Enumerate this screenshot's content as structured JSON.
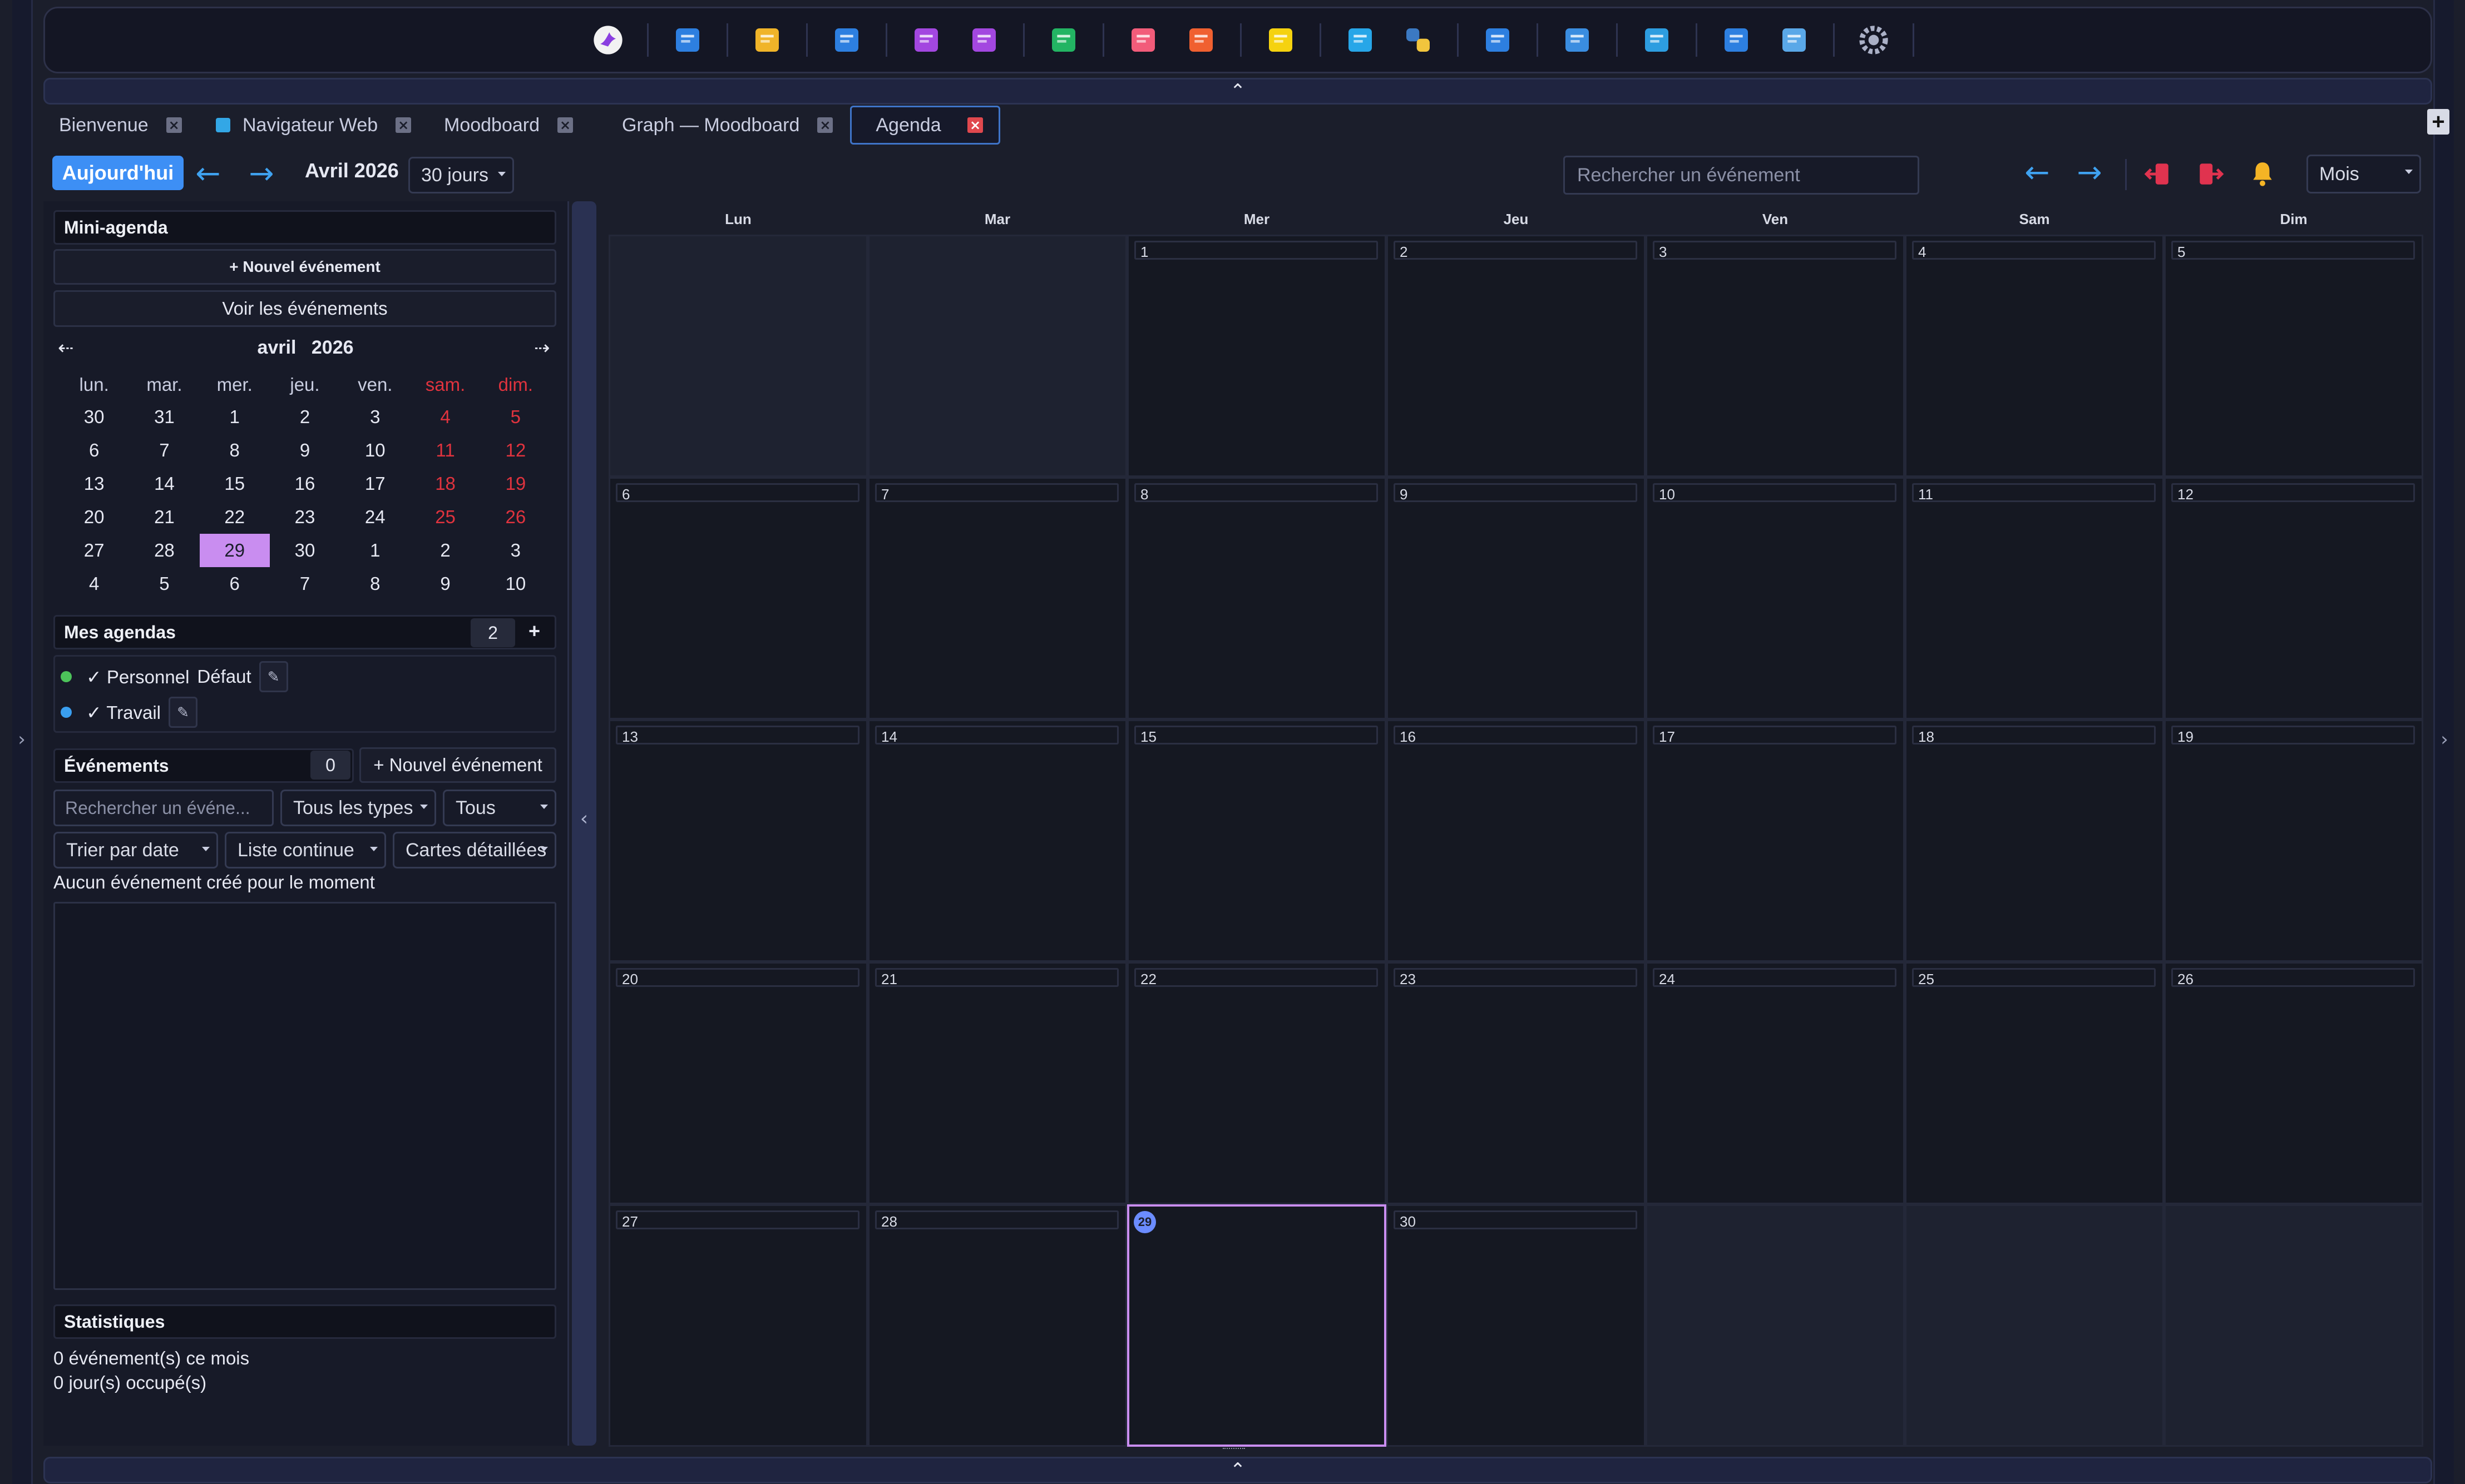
{
  "dock": {
    "icons": [
      "app-logo-icon",
      "browser-window-icon",
      "image-gallery-icon",
      "calendar-icon",
      "video-file-icon",
      "document-purple-icon",
      "spreadsheet-icon",
      "pdf-icon",
      "epub-icon",
      "sticky-note-icon",
      "code-file-icon",
      "python-icon",
      "waveform-icon",
      "photo-icon",
      "music-folder-icon",
      "film-icon",
      "folder-icon",
      "settings-gear-icon"
    ]
  },
  "collapse_top": "⌃",
  "collapse_bottom": "⌃",
  "tabs": [
    {
      "label": "Bienvenue",
      "active": false,
      "icon": false
    },
    {
      "label": "Navigateur Web",
      "active": false,
      "icon": true
    },
    {
      "label": "Moodboard",
      "active": false,
      "icon": false
    },
    {
      "label": "Graph — Moodboard",
      "active": false,
      "icon": false
    },
    {
      "label": "Agenda",
      "active": true,
      "icon": false
    }
  ],
  "tab_add": "+",
  "toolbar": {
    "today": "Aujourd'hui",
    "prev": "←",
    "next": "→",
    "month_label": "Avril 2026",
    "range_select": "30 jours",
    "search_placeholder": "Rechercher un événement",
    "view_select": "Mois"
  },
  "mini_agenda": {
    "title": "Mini-agenda",
    "new_event": "+ Nouvel événement",
    "view_events": "Voir les événements",
    "prev": "⇠",
    "next": "⇢",
    "month": "avril",
    "year": "2026",
    "weekdays": [
      "lun.",
      "mar.",
      "mer.",
      "jeu.",
      "ven.",
      "sam.",
      "dim."
    ],
    "weeks": [
      [
        "30",
        "31",
        "1",
        "2",
        "3",
        "4",
        "5"
      ],
      [
        "6",
        "7",
        "8",
        "9",
        "10",
        "11",
        "12"
      ],
      [
        "13",
        "14",
        "15",
        "16",
        "17",
        "18",
        "19"
      ],
      [
        "20",
        "21",
        "22",
        "23",
        "24",
        "25",
        "26"
      ],
      [
        "27",
        "28",
        "29",
        "30",
        "1",
        "2",
        "3"
      ],
      [
        "4",
        "5",
        "6",
        "7",
        "8",
        "9",
        "10"
      ]
    ],
    "today": "29"
  },
  "calendars": {
    "title": "Mes agendas",
    "count": "2",
    "add": "+",
    "items": [
      {
        "label": "✓ Personnel",
        "tag": "Défaut",
        "color": "#4cc35a"
      },
      {
        "label": "✓ Travail",
        "tag": "",
        "color": "#3a9ff0"
      }
    ],
    "edit_icon": "✎"
  },
  "events": {
    "title": "Événements",
    "count": "0",
    "new_event": "+ Nouvel événement",
    "search_placeholder": "Rechercher un événe...",
    "type_filter": "Tous les types",
    "scope_filter": "Tous",
    "sort": "Trier par date",
    "list_mode": "Liste continue",
    "card_mode": "Cartes détaillées",
    "empty_text": "Aucun événement créé pour le moment"
  },
  "stats": {
    "title": "Statistiques",
    "line1": "0 événement(s) ce mois",
    "line2": "0 jour(s) occupé(s)"
  },
  "month_grid": {
    "weekdays": [
      "Lun",
      "Mar",
      "Mer",
      "Jeu",
      "Ven",
      "Sam",
      "Dim"
    ],
    "days": [
      "",
      "",
      "1",
      "2",
      "3",
      "4",
      "5",
      "6",
      "7",
      "8",
      "9",
      "10",
      "11",
      "12",
      "13",
      "14",
      "15",
      "16",
      "17",
      "18",
      "19",
      "20",
      "21",
      "22",
      "23",
      "24",
      "25",
      "26",
      "27",
      "28",
      "29",
      "30",
      "",
      "",
      ""
    ],
    "today": "29",
    "today_badge": "29"
  },
  "colors": {
    "accent": "#3d8ff5",
    "today": "#c98df0",
    "weekend": "#e0333e"
  }
}
